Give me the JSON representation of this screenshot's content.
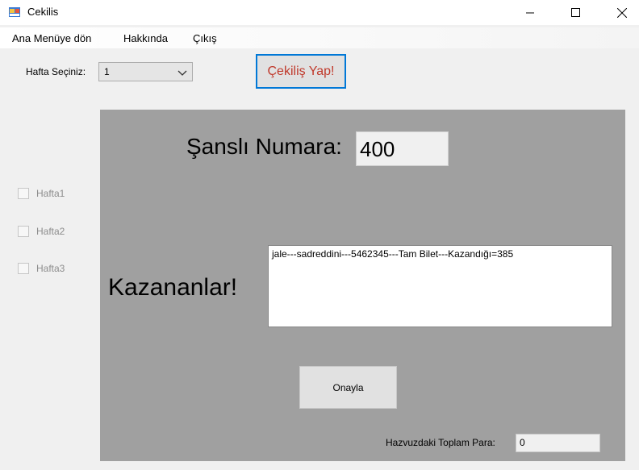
{
  "window": {
    "title": "Cekilis"
  },
  "menu": {
    "items": [
      "Ana Menüye dön",
      "Hakkında",
      "Çıkış"
    ]
  },
  "week": {
    "label": "Hafta Seçiniz:",
    "selected": "1"
  },
  "draw_button": {
    "label": "Çekiliş Yap!",
    "color": "#c0392b"
  },
  "checkboxes": [
    {
      "label": "Hafta1",
      "checked": false
    },
    {
      "label": "Hafta2",
      "checked": false
    },
    {
      "label": "Hafta3",
      "checked": false
    }
  ],
  "lucky": {
    "label": "Şanslı Numara:",
    "value": "400"
  },
  "winners": {
    "label": "Kazananlar!",
    "text": "jale---sadreddini---5462345---Tam Bilet---Kazandığı=385"
  },
  "confirm_button": {
    "label": "Onayla"
  },
  "pool": {
    "label": "Hazvuzdaki Toplam Para:",
    "value": "0"
  },
  "colors": {
    "panel": "#a0a0a0",
    "accent": "#0078d7"
  }
}
